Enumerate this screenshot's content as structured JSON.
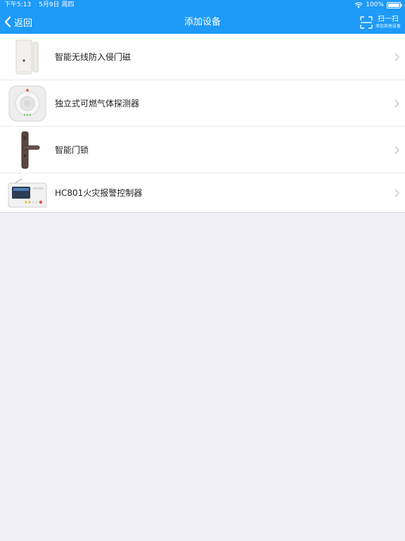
{
  "status_bar": {
    "time": "下午5:13",
    "date": "5月9日 周四",
    "battery": "100%"
  },
  "navbar": {
    "back_label": "返回",
    "title": "添加设备",
    "scan_label": "扫一扫",
    "scan_sublabel": "添加其他设备"
  },
  "devices": [
    {
      "label": "智能无线防入侵门磁",
      "icon": "door-sensor-icon"
    },
    {
      "label": "独立式可燃气体探测器",
      "icon": "gas-detector-icon"
    },
    {
      "label": "智能门锁",
      "icon": "door-lock-icon"
    },
    {
      "label": "HC801火灾报警控制器",
      "icon": "fire-alarm-controller-icon"
    }
  ],
  "colors": {
    "nav_background": "#1e9af8",
    "page_background": "#f0f0f6"
  }
}
